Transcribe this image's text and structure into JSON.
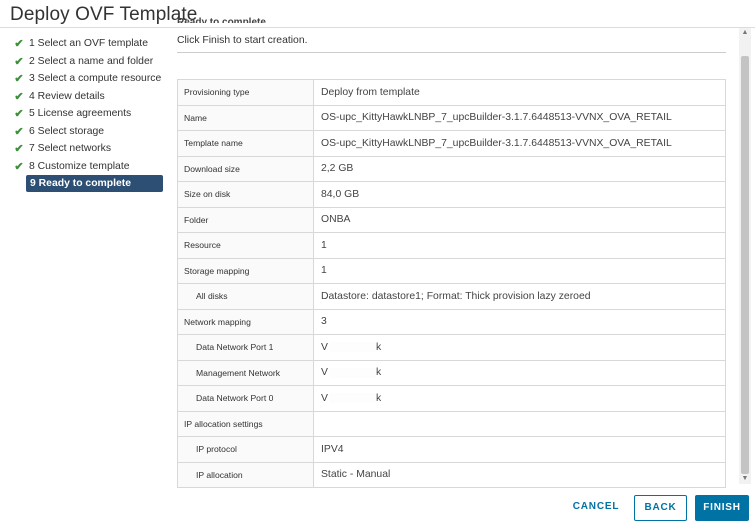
{
  "dialog": {
    "title": "Deploy OVF Template"
  },
  "steps": [
    {
      "label": "1 Select an OVF template",
      "done": true
    },
    {
      "label": "2 Select a name and folder",
      "done": true
    },
    {
      "label": "3 Select a compute resource",
      "done": true
    },
    {
      "label": "4 Review details",
      "done": true
    },
    {
      "label": "5 License agreements",
      "done": true
    },
    {
      "label": "6 Select storage",
      "done": true
    },
    {
      "label": "7 Select networks",
      "done": true
    },
    {
      "label": "8 Customize template",
      "done": true
    },
    {
      "label": "9 Ready to complete",
      "done": false,
      "active": true
    }
  ],
  "page": {
    "heading": "Ready to complete",
    "instruction": "Click Finish to start creation."
  },
  "summary": [
    {
      "key": "Provisioning type",
      "value": "Deploy from template"
    },
    {
      "key": "Name",
      "value": "OS-upc_KittyHawkLNBP_7_upcBuilder-3.1.7.6448513-VVNX_OVA_RETAIL"
    },
    {
      "key": "Template name",
      "value": "OS-upc_KittyHawkLNBP_7_upcBuilder-3.1.7.6448513-VVNX_OVA_RETAIL"
    },
    {
      "key": "Download size",
      "value": "2,2 GB"
    },
    {
      "key": "Size on disk",
      "value": "84,0 GB"
    },
    {
      "key": "Folder",
      "value": "ONBA"
    },
    {
      "key": "Resource",
      "value": "1"
    },
    {
      "key": "Storage mapping",
      "value": "1"
    },
    {
      "key": "All disks",
      "value": "Datastore: datastore1; Format: Thick provision lazy zeroed",
      "sub": true
    },
    {
      "key": "Network mapping",
      "value": "3"
    },
    {
      "key": "Data Network Port 1",
      "value": "V",
      "tail": "k",
      "sub": true
    },
    {
      "key": "Management Network",
      "value": "V",
      "tail": "k",
      "sub": true
    },
    {
      "key": "Data Network Port 0",
      "value": "V",
      "tail": "k",
      "sub": true
    },
    {
      "key": "IP allocation settings",
      "value": ""
    },
    {
      "key": "IP protocol",
      "value": "IPV4",
      "sub": true
    },
    {
      "key": "IP allocation",
      "value": "Static - Manual",
      "sub": true
    }
  ],
  "buttons": {
    "cancel": "CANCEL",
    "back": "BACK",
    "finish": "FINISH"
  },
  "colors": {
    "accent": "#0072a3",
    "active_step": "#2d4f73",
    "check": "#3f8f3c"
  },
  "icons": {
    "step_done": "checkmark-icon",
    "scroll_up": "arrow-up-icon",
    "scroll_down": "arrow-down-icon"
  }
}
